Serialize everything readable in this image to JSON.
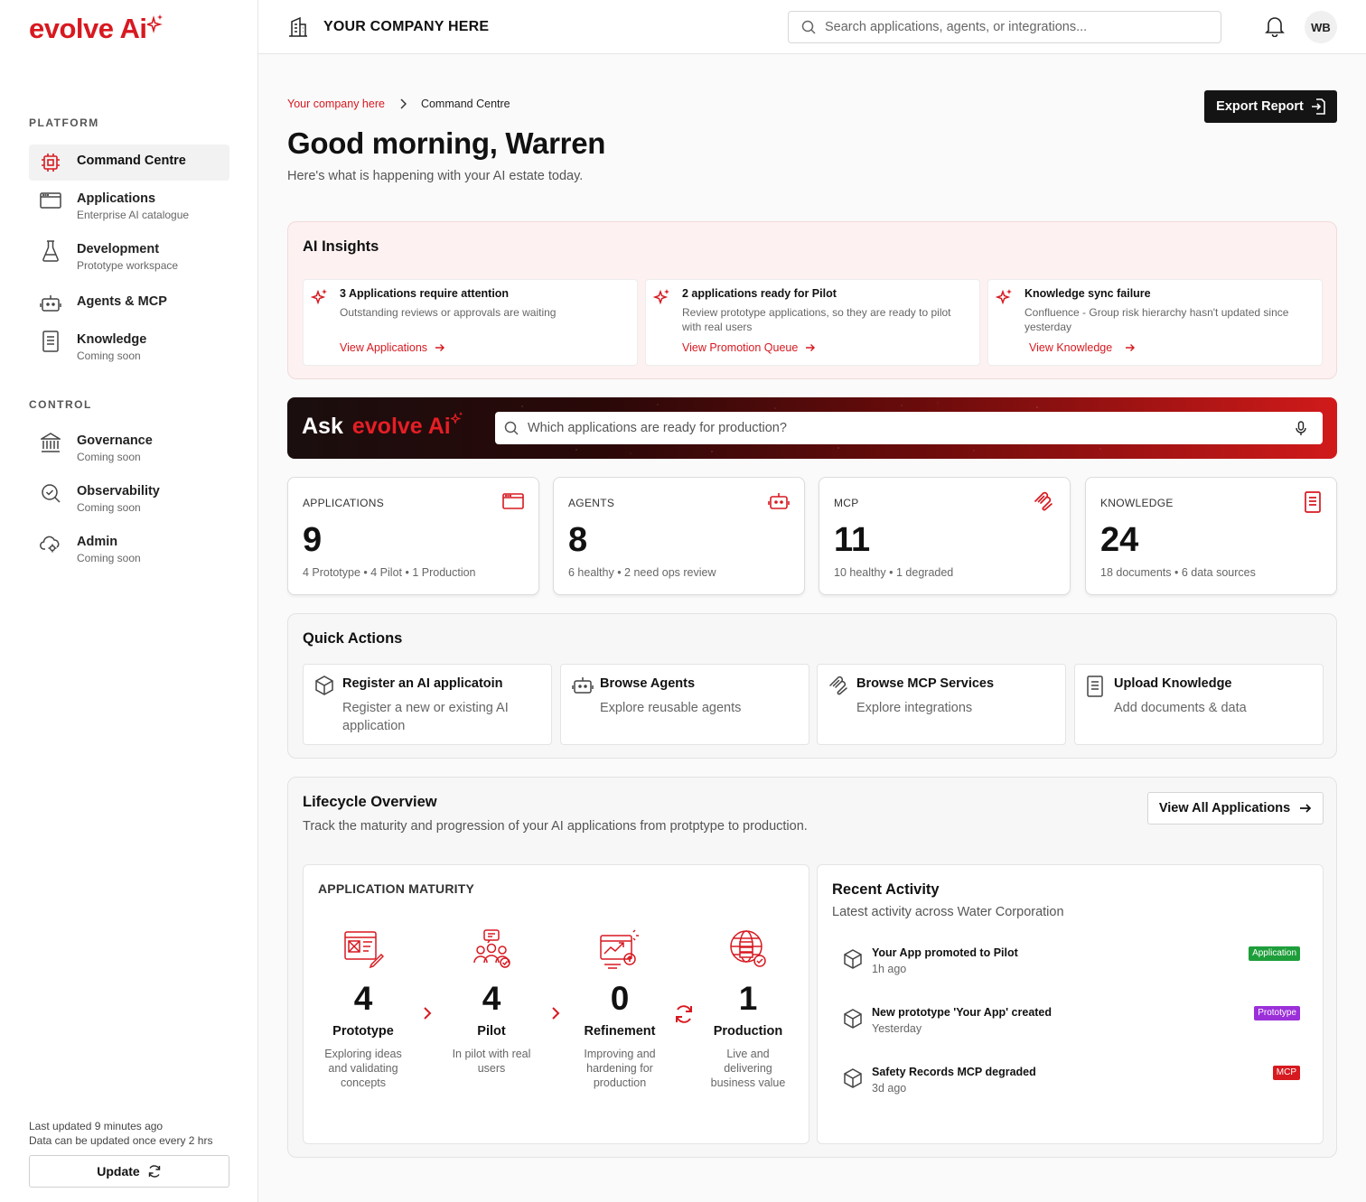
{
  "brand": {
    "logo": "evolve Ai",
    "accent": "#d71920"
  },
  "sidebar": {
    "sections": [
      "PLATFORM",
      "CONTROL"
    ],
    "items": [
      {
        "label": "Command Centre",
        "sub": "",
        "icon": "chip-icon",
        "active": true
      },
      {
        "label": "Applications",
        "sub": "Enterprise AI catalogue",
        "icon": "window-icon"
      },
      {
        "label": "Development",
        "sub": "Prototype workspace",
        "icon": "flask-icon"
      },
      {
        "label": "Agents & MCP",
        "sub": "",
        "icon": "robot-icon"
      },
      {
        "label": "Knowledge",
        "sub": "Coming soon",
        "icon": "document-icon"
      },
      {
        "label": "Governance",
        "sub": "Coming soon",
        "icon": "bank-icon"
      },
      {
        "label": "Observability",
        "sub": "Coming soon",
        "icon": "search-check-icon"
      },
      {
        "label": "Admin",
        "sub": "Coming soon",
        "icon": "cloud-gear-icon"
      }
    ],
    "footer": {
      "last_updated": "Last updated 9 minutes ago",
      "frequency": "Data can be updated once every 2 hrs",
      "update_label": "Update"
    }
  },
  "topbar": {
    "company": "YOUR COMPANY HERE",
    "search_placeholder": "Search applications, agents, or integrations...",
    "avatar": "WB"
  },
  "header": {
    "breadcrumb": [
      "Your company here",
      "Command Centre"
    ],
    "greeting": "Good morning, Warren",
    "subtitle": "Here's what is happening with your AI estate today.",
    "export_label": "Export Report"
  },
  "insights": {
    "title": "AI Insights",
    "cards": [
      {
        "title": "3 Applications require attention",
        "desc": "Outstanding reviews or approvals are waiting",
        "link": "View Applications"
      },
      {
        "title": "2 applications ready for Pilot",
        "desc": "Review prototype applications, so they are ready to pilot with real users",
        "link": "View Promotion Queue"
      },
      {
        "title": "Knowledge sync failure",
        "desc": "Confluence - Group risk hierarchy hasn't updated since yesterday",
        "link": "View Knowledge"
      }
    ]
  },
  "ask": {
    "label": "Ask",
    "brand": "evolve Ai",
    "placeholder": "Which applications are ready for production?"
  },
  "stats": [
    {
      "label": "APPLICATIONS",
      "value": "9",
      "sub": "4 Prototype • 4 Pilot • 1 Production",
      "icon": "window-icon"
    },
    {
      "label": "AGENTS",
      "value": "8",
      "sub": "6 healthy • 2 need ops review",
      "icon": "robot-icon"
    },
    {
      "label": "MCP",
      "value": "11",
      "sub": "10 healthy • 1 degraded",
      "icon": "mcp-icon"
    },
    {
      "label": "KNOWLEDGE",
      "value": "24",
      "sub": "18 documents • 6 data sources",
      "icon": "document-icon"
    }
  ],
  "quick_actions": {
    "title": "Quick Actions",
    "items": [
      {
        "title": "Register an AI applicatoin",
        "desc": "Register a new or existing AI application",
        "icon": "cube-icon"
      },
      {
        "title": "Browse Agents",
        "desc": "Explore reusable agents",
        "icon": "robot-icon"
      },
      {
        "title": "Browse MCP Services",
        "desc": "Explore integrations",
        "icon": "mcp-icon"
      },
      {
        "title": "Upload Knowledge",
        "desc": "Add documents & data",
        "icon": "document-icon"
      }
    ]
  },
  "lifecycle": {
    "title": "Lifecycle Overview",
    "subtitle": "Track the maturity and progression of your AI applications from protptype to production.",
    "view_all": "View All Applications",
    "maturity_title": "APPLICATION MATURITY",
    "stages": [
      {
        "count": "4",
        "name": "Prototype",
        "desc": "Exploring ideas and validating concepts",
        "icon": "blueprint-icon"
      },
      {
        "count": "4",
        "name": "Pilot",
        "desc": "In pilot with real users",
        "icon": "users-chat-icon"
      },
      {
        "count": "0",
        "name": "Refinement",
        "desc": "Improving and hardening for production",
        "icon": "chart-browser-icon"
      },
      {
        "count": "1",
        "name": "Production",
        "desc": "Live and delivering business value",
        "icon": "globe-server-icon"
      }
    ],
    "activity": {
      "title": "Recent Activity",
      "subtitle": "Latest activity across Water Corporation",
      "items": [
        {
          "name": "Your App promoted to Pilot",
          "time": "1h ago",
          "badge": "Application",
          "badge_color": "#1e9e3a"
        },
        {
          "name": "New prototype 'Your App' created",
          "time": "Yesterday",
          "badge": "Prototype",
          "badge_color": "#9b30d9"
        },
        {
          "name": "Safety Records MCP degraded",
          "time": "3d ago",
          "badge": "MCP",
          "badge_color": "#d71920"
        }
      ]
    }
  }
}
